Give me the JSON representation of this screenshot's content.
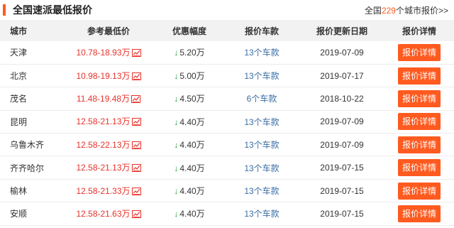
{
  "header": {
    "title": "全国速派最低报价",
    "city_link_prefix": "全国",
    "city_count": "229",
    "city_link_suffix": "个城市报价>>"
  },
  "columns": {
    "city": "城市",
    "price": "参考最低价",
    "discount": "优惠幅度",
    "models": "报价车款",
    "date": "报价更新日期",
    "detail": "报价详情"
  },
  "icons": {
    "trend": "price-trend-icon",
    "arrow": "down-arrow-icon"
  },
  "colors": {
    "accent": "#ff5a1f",
    "price": "#e6322a",
    "discount_arrow": "#1a9e3a",
    "link": "#3a6ea5"
  },
  "rows": [
    {
      "city": "天津",
      "price": "10.78-18.93万",
      "arrow": "↓",
      "discount": "5.20万",
      "models": "13个车款",
      "date": "2019-07-09",
      "detail": "报价详情"
    },
    {
      "city": "北京",
      "price": "10.98-19.13万",
      "arrow": "↓",
      "discount": "5.00万",
      "models": "13个车款",
      "date": "2019-07-17",
      "detail": "报价详情"
    },
    {
      "city": "茂名",
      "price": "11.48-19.48万",
      "arrow": "↓",
      "discount": "4.50万",
      "models": "6个车款",
      "date": "2018-10-22",
      "detail": "报价详情"
    },
    {
      "city": "昆明",
      "price": "12.58-21.13万",
      "arrow": "↓",
      "discount": "4.40万",
      "models": "13个车款",
      "date": "2019-07-09",
      "detail": "报价详情"
    },
    {
      "city": "乌鲁木齐",
      "price": "12.58-22.13万",
      "arrow": "↓",
      "discount": "4.40万",
      "models": "13个车款",
      "date": "2019-07-09",
      "detail": "报价详情"
    },
    {
      "city": "齐齐哈尔",
      "price": "12.58-21.13万",
      "arrow": "↓",
      "discount": "4.40万",
      "models": "13个车款",
      "date": "2019-07-15",
      "detail": "报价详情"
    },
    {
      "city": "榆林",
      "price": "12.58-21.33万",
      "arrow": "↓",
      "discount": "4.40万",
      "models": "13个车款",
      "date": "2019-07-15",
      "detail": "报价详情"
    },
    {
      "city": "安顺",
      "price": "12.58-21.63万",
      "arrow": "↓",
      "discount": "4.40万",
      "models": "13个车款",
      "date": "2019-07-15",
      "detail": "报价详情"
    }
  ]
}
